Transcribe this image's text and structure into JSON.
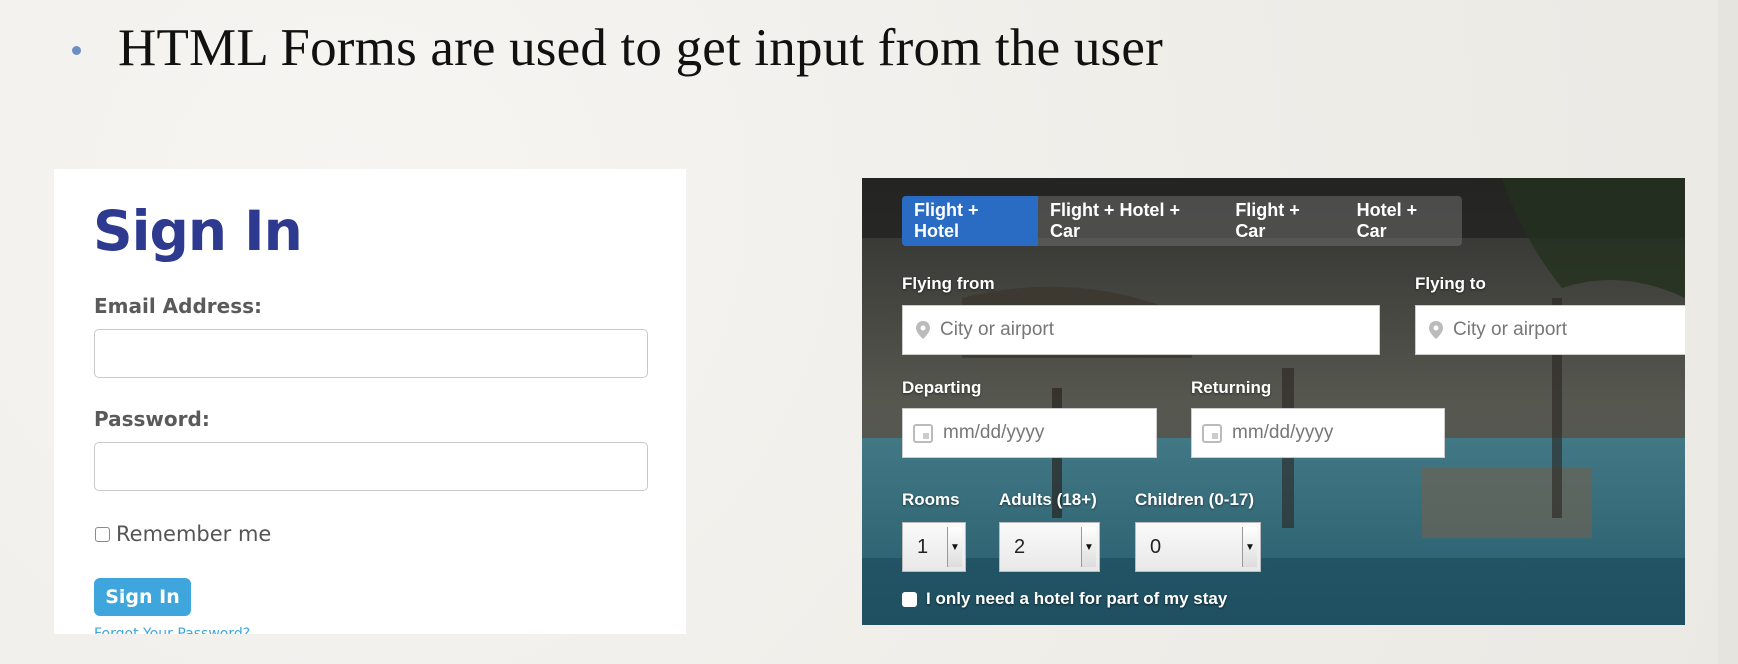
{
  "slide": {
    "headline": "HTML Forms are used to get input from the user"
  },
  "signin_form": {
    "title": "Sign In",
    "email_label": "Email Address:",
    "email_value": "",
    "password_label": "Password:",
    "password_value": "",
    "remember_label": "Remember me",
    "remember_checked": false,
    "submit_label": "Sign In",
    "forgot_link": "Forgot Your Password?"
  },
  "travel_form": {
    "tabs": [
      {
        "label": "Flight + Hotel",
        "active": true
      },
      {
        "label": "Flight + Hotel + Car",
        "active": false
      },
      {
        "label": "Flight + Car",
        "active": false
      },
      {
        "label": "Hotel + Car",
        "active": false
      }
    ],
    "flying_from": {
      "label": "Flying from",
      "placeholder": "City or airport"
    },
    "flying_to": {
      "label": "Flying to",
      "placeholder": "City or airport"
    },
    "departing": {
      "label": "Departing",
      "placeholder": "mm/dd/yyyy"
    },
    "returning": {
      "label": "Returning",
      "placeholder": "mm/dd/yyyy"
    },
    "rooms": {
      "label": "Rooms",
      "value": "1"
    },
    "adults": {
      "label": "Adults (18+)",
      "value": "2"
    },
    "children": {
      "label": "Children (0-17)",
      "value": "0"
    },
    "hotel_part_stay": {
      "label": "I only need a hotel for part of my stay",
      "checked": false
    }
  },
  "colors": {
    "accent_blue": "#2a6cc4",
    "signin_title": "#2e3a8f",
    "signin_button": "#3ea6dd",
    "bullet": "#6a8fc2"
  }
}
